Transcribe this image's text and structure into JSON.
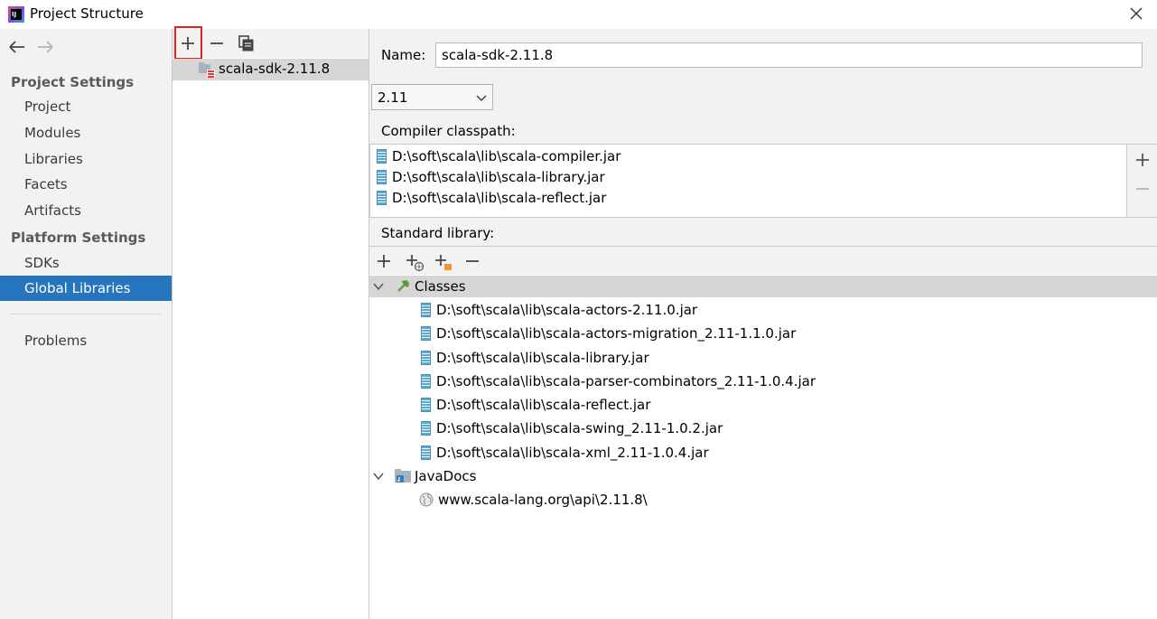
{
  "window": {
    "title": "Project Structure",
    "app_icon_text": "IJ"
  },
  "sidebar": {
    "project_settings_heading": "Project Settings",
    "project_items": [
      "Project",
      "Modules",
      "Libraries",
      "Facets",
      "Artifacts"
    ],
    "platform_settings_heading": "Platform Settings",
    "platform_items": [
      "SDKs",
      "Global Libraries"
    ],
    "selected_item": "Global Libraries",
    "problems_label": "Problems"
  },
  "library_list": {
    "items": [
      "scala-sdk-2.11.8"
    ],
    "selected": "scala-sdk-2.11.8"
  },
  "detail": {
    "name_label": "Name:",
    "name_value": "scala-sdk-2.11.8",
    "version_value": "2.11",
    "compiler_classpath_label": "Compiler classpath:",
    "compiler_classpath": [
      "D:\\soft\\scala\\lib\\scala-compiler.jar",
      "D:\\soft\\scala\\lib\\scala-library.jar",
      "D:\\soft\\scala\\lib\\scala-reflect.jar"
    ],
    "standard_library_label": "Standard library:",
    "classes_label": "Classes",
    "classes": [
      "D:\\soft\\scala\\lib\\scala-actors-2.11.0.jar",
      "D:\\soft\\scala\\lib\\scala-actors-migration_2.11-1.1.0.jar",
      "D:\\soft\\scala\\lib\\scala-library.jar",
      "D:\\soft\\scala\\lib\\scala-parser-combinators_2.11-1.0.4.jar",
      "D:\\soft\\scala\\lib\\scala-reflect.jar",
      "D:\\soft\\scala\\lib\\scala-swing_2.11-1.0.2.jar",
      "D:\\soft\\scala\\lib\\scala-xml_2.11-1.0.4.jar"
    ],
    "javadocs_label": "JavaDocs",
    "javadocs": [
      "www.scala-lang.org\\api\\2.11.8\\"
    ]
  },
  "colors": {
    "selection": "#2675bf",
    "highlight_box": "#e02424",
    "panel_bg": "#f2f2f2"
  },
  "icons": {
    "back": "arrow-left-icon",
    "forward": "arrow-right-icon",
    "add": "plus-icon",
    "remove": "minus-icon",
    "copy": "copy-icon",
    "close": "close-icon",
    "jar": "jar-icon",
    "classes": "hammer-icon",
    "javadocs": "folder-doc-icon",
    "web": "globe-icon"
  }
}
